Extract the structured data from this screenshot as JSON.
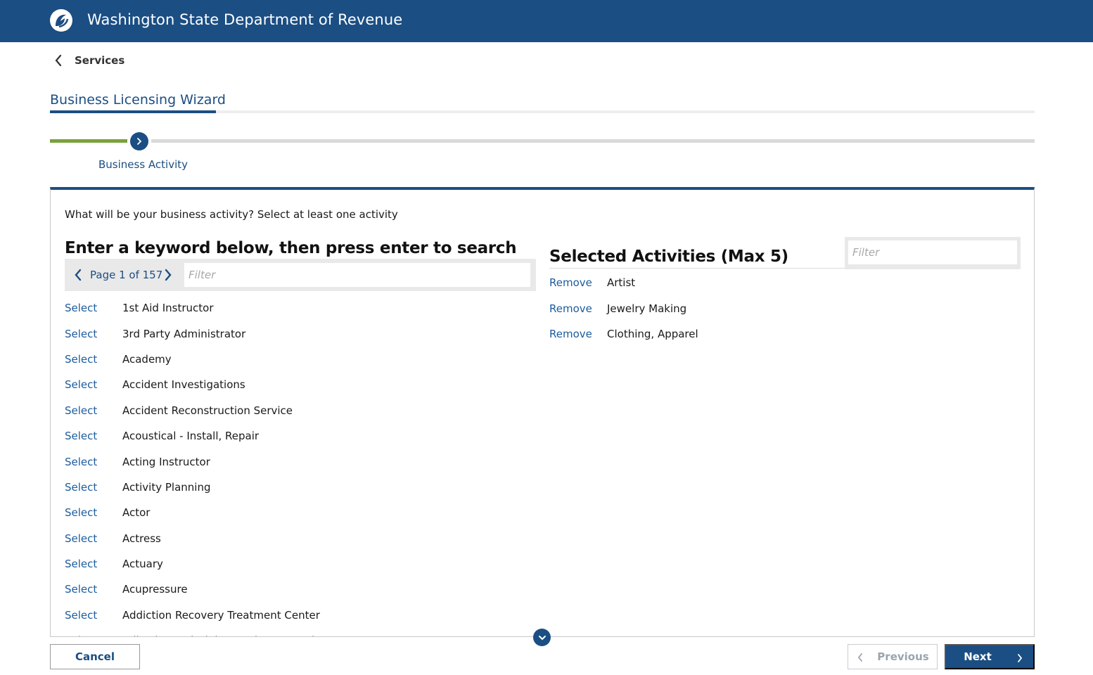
{
  "header": {
    "title": "Washington State Department of Revenue",
    "logo_icon": "dor-logo-icon",
    "background_color": "#1b4e83"
  },
  "nav": {
    "back_label": "Services"
  },
  "wizard": {
    "title": "Business Licensing Wizard",
    "current_step_label": "Business Activity",
    "progress_color": "#79a23a"
  },
  "panel": {
    "prompt": "What will be your business activity? Select at least one activity",
    "search": {
      "heading": "Enter a keyword below, then press enter to search",
      "page_label": "Page 1 of 157",
      "filter_placeholder": "Filter",
      "filter_value": ""
    },
    "activities": [
      {
        "action": "Select",
        "name": "1st Aid Instructor"
      },
      {
        "action": "Select",
        "name": "3rd Party Administrator"
      },
      {
        "action": "Select",
        "name": "Academy"
      },
      {
        "action": "Select",
        "name": "Accident Investigations"
      },
      {
        "action": "Select",
        "name": "Accident Reconstruction Service"
      },
      {
        "action": "Select",
        "name": "Acoustical - Install, Repair"
      },
      {
        "action": "Select",
        "name": "Acting Instructor"
      },
      {
        "action": "Select",
        "name": "Activity Planning"
      },
      {
        "action": "Select",
        "name": "Actor"
      },
      {
        "action": "Select",
        "name": "Actress"
      },
      {
        "action": "Select",
        "name": "Actuary"
      },
      {
        "action": "Select",
        "name": "Acupressure"
      },
      {
        "action": "Select",
        "name": "Addiction Recovery Treatment Center"
      },
      {
        "action": "Select",
        "name": "Adhesive and Gluing Equipment, Sales"
      }
    ],
    "selected": {
      "heading": "Selected Activities (Max 5)",
      "filter_placeholder": "Filter",
      "filter_value": "",
      "items": [
        {
          "action": "Remove",
          "name": "Artist"
        },
        {
          "action": "Remove",
          "name": "Jewelry Making"
        },
        {
          "action": "Remove",
          "name": "Clothing, Apparel"
        }
      ]
    }
  },
  "footer": {
    "cancel_label": "Cancel",
    "previous_label": "Previous",
    "next_label": "Next"
  }
}
